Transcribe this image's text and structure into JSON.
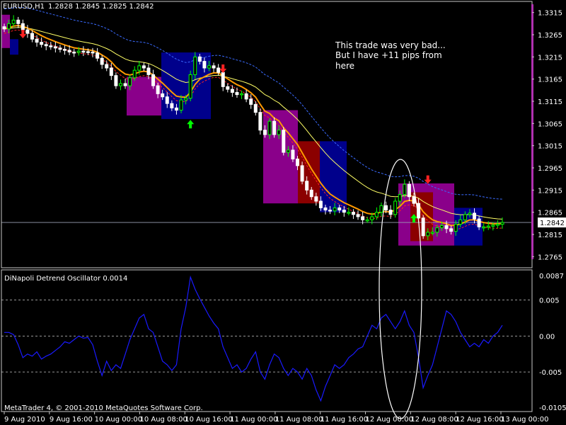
{
  "header": {
    "symbol": "EURUSD,H1",
    "ohlc": "1.2828 1.2845 1.2825 1.2842"
  },
  "annotation": {
    "lines": [
      "This trade was very bad...",
      "But I have +11 pips from",
      "here"
    ]
  },
  "oscillator": {
    "title": "DiNapoli Detrend Oscillator 0.0014",
    "copyright": "MetaTrader 4, © 2001-2010 MetaQuotes Software Corp."
  },
  "colors": {
    "background": "#000000",
    "bull_candle": "#00ff00",
    "bear_candle": "#ffffff",
    "ema_orange": "#ff9900",
    "ema_yellow": "#ffff66",
    "band_blue": "#3a6bff",
    "band_red": "#ff2222",
    "oscillator": "#1a1aff",
    "box_magenta": "#8a008a",
    "box_darkred": "#8b0000",
    "box_blue": "#00008b",
    "arrow_up": "#00ff00",
    "arrow_down": "#ff2222",
    "price_scale_bar": "#b030b0"
  },
  "chart_data": [
    {
      "type": "candlestick",
      "title": "EURUSD,H1",
      "ylim": [
        1.274,
        1.334
      ],
      "current_price": "1.2842",
      "y_ticks": [
        "1.3315",
        "1.3265",
        "1.3215",
        "1.3165",
        "1.3115",
        "1.3065",
        "1.3015",
        "1.2965",
        "1.2915",
        "1.2865",
        "1.2815",
        "1.2765"
      ],
      "x_ticks": [
        "9 Aug 2010",
        "9 Aug 16:00",
        "10 Aug 00:00",
        "10 Aug 08:00",
        "10 Aug 16:00",
        "11 Aug 00:00",
        "11 Aug 08:00",
        "11 Aug 16:00",
        "12 Aug 00:00",
        "12 Aug 08:00",
        "12 Aug 16:00",
        "13 Aug 00:00"
      ],
      "close": [
        1.3278,
        1.329,
        1.3298,
        1.329,
        1.3276,
        1.3268,
        1.3255,
        1.3248,
        1.3243,
        1.324,
        1.3238,
        1.3235,
        1.3232,
        1.323,
        1.3226,
        1.3225,
        1.3228,
        1.3227,
        1.3226,
        1.3224,
        1.3212,
        1.3198,
        1.319,
        1.3173,
        1.315,
        1.3155,
        1.315,
        1.3168,
        1.3185,
        1.3195,
        1.319,
        1.3175,
        1.315,
        1.3132,
        1.3125,
        1.311,
        1.31,
        1.3095,
        1.3118,
        1.3122,
        1.3175,
        1.3215,
        1.3205,
        1.319,
        1.3195,
        1.319,
        1.318,
        1.3148,
        1.3142,
        1.3135,
        1.313,
        1.3132,
        1.312,
        1.3108,
        1.309,
        1.305,
        1.304,
        1.307,
        1.304,
        1.305,
        1.3,
        1.3005,
        1.2985,
        1.297,
        1.2935,
        1.2915,
        1.29,
        1.289,
        1.2875,
        1.287,
        1.2868,
        1.2875,
        1.287,
        1.2865,
        1.2865,
        1.286,
        1.2855,
        1.2848,
        1.2848,
        1.2855,
        1.2865,
        1.288,
        1.287,
        1.286,
        1.289,
        1.2905,
        1.2928,
        1.29,
        1.2885,
        1.2852,
        1.2812,
        1.282,
        1.282,
        1.283,
        1.2835,
        1.2828,
        1.2822,
        1.2838,
        1.2848,
        1.286,
        1.2863,
        1.285,
        1.2832,
        1.2832,
        1.2834,
        1.2836,
        1.2838,
        1.2842
      ],
      "oscillator": {
        "ylim": [
          -0.0105,
          0.0092
        ],
        "y_ticks": [
          "0.0087",
          "0.005",
          "0.00",
          "-0.005",
          "-0.0105"
        ],
        "values": [
          0.0005,
          0.0005,
          0.0002,
          -0.0012,
          -0.003,
          -0.0025,
          -0.0028,
          -0.0022,
          -0.0032,
          -0.0028,
          -0.0025,
          -0.002,
          -0.0015,
          -0.0008,
          -0.001,
          -0.0005,
          0.0,
          -0.0003,
          -0.0002,
          -0.0012,
          -0.0035,
          -0.0055,
          -0.0035,
          -0.0048,
          -0.004,
          -0.0045,
          -0.0025,
          -0.0005,
          0.001,
          0.0025,
          0.003,
          0.001,
          0.0005,
          -0.0015,
          -0.0035,
          -0.004,
          -0.0048,
          -0.004,
          0.001,
          0.004,
          0.0082,
          0.0065,
          0.0052,
          0.004,
          0.0028,
          0.0018,
          0.001,
          -0.0015,
          -0.003,
          -0.0045,
          -0.004,
          -0.005,
          -0.0045,
          -0.0032,
          -0.0022,
          -0.005,
          -0.006,
          -0.004,
          -0.0025,
          -0.003,
          -0.0045,
          -0.0055,
          -0.0045,
          -0.005,
          -0.006,
          -0.0045,
          -0.0055,
          -0.0075,
          -0.009,
          -0.007,
          -0.0055,
          -0.004,
          -0.0045,
          -0.004,
          -0.003,
          -0.0025,
          -0.0018,
          -0.0015,
          0.0,
          0.0015,
          0.001,
          0.0025,
          0.003,
          0.002,
          0.001,
          0.002,
          0.0035,
          0.0015,
          0.0005,
          -0.003,
          -0.0072,
          -0.0055,
          -0.004,
          -0.0015,
          0.001,
          0.0035,
          0.003,
          0.002,
          0.0005,
          -0.0005,
          -0.0015,
          -0.001,
          -0.0015,
          -0.0005,
          -0.001,
          0.0,
          0.0005,
          0.0015
        ]
      }
    }
  ]
}
